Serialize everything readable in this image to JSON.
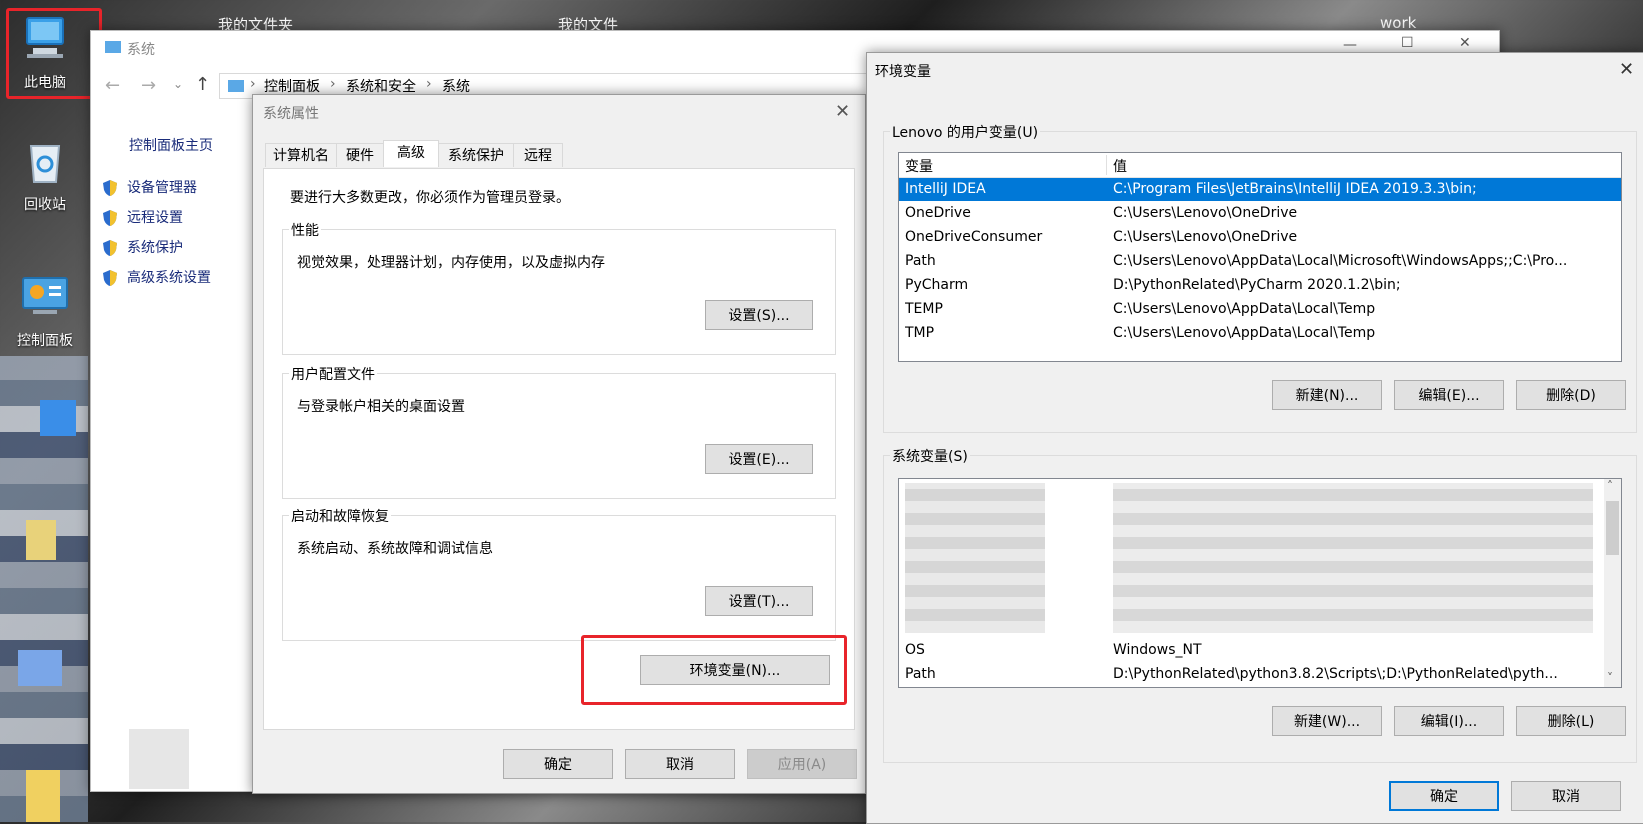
{
  "desktop": {
    "icons": [
      {
        "label": "此电脑",
        "icon": "computer-icon"
      },
      {
        "label": "回收站",
        "icon": "recycle-bin-icon"
      },
      {
        "label": "控制面板",
        "icon": "control-panel-icon"
      }
    ],
    "taskbar_labels": [
      "我的文件夹",
      "我的文件",
      "work"
    ]
  },
  "explorer": {
    "title": "系统",
    "breadcrumb": [
      "控制面板",
      "系统和安全",
      "系统"
    ],
    "sidebar_title": "控制面板主页",
    "sidebar_items": [
      "设备管理器",
      "远程设置",
      "系统保护",
      "高级系统设置"
    ]
  },
  "sysprops": {
    "title": "系统属性",
    "tabs": [
      "计算机名",
      "硬件",
      "高级",
      "系统保护",
      "远程"
    ],
    "active_tab": "高级",
    "admin_note": "要进行大多数更改，你必须作为管理员登录。",
    "groups": [
      {
        "title": "性能",
        "desc": "视觉效果，处理器计划，内存使用，以及虚拟内存",
        "button": "设置(S)..."
      },
      {
        "title": "用户配置文件",
        "desc": "与登录帐户相关的桌面设置",
        "button": "设置(E)..."
      },
      {
        "title": "启动和故障恢复",
        "desc": "系统启动、系统故障和调试信息",
        "button": "设置(T)..."
      }
    ],
    "env_button": "环境变量(N)...",
    "ok": "确定",
    "cancel": "取消",
    "apply": "应用(A)"
  },
  "envvars": {
    "title": "环境变量",
    "user_group_title": "Lenovo 的用户变量(U)",
    "col_var": "变量",
    "col_val": "值",
    "user_vars": [
      {
        "name": "IntelliJ IDEA",
        "value": "C:\\Program Files\\JetBrains\\IntelliJ IDEA 2019.3.3\\bin;"
      },
      {
        "name": "OneDrive",
        "value": "C:\\Users\\Lenovo\\OneDrive"
      },
      {
        "name": "OneDriveConsumer",
        "value": "C:\\Users\\Lenovo\\OneDrive"
      },
      {
        "name": "Path",
        "value": "C:\\Users\\Lenovo\\AppData\\Local\\Microsoft\\WindowsApps;;C:\\Pro..."
      },
      {
        "name": "PyCharm",
        "value": "D:\\PythonRelated\\PyCharm 2020.1.2\\bin;"
      },
      {
        "name": "TEMP",
        "value": "C:\\Users\\Lenovo\\AppData\\Local\\Temp"
      },
      {
        "name": "TMP",
        "value": "C:\\Users\\Lenovo\\AppData\\Local\\Temp"
      }
    ],
    "user_buttons": [
      "新建(N)...",
      "编辑(E)...",
      "删除(D)"
    ],
    "sys_group_title": "系统变量(S)",
    "sys_vars_visible": [
      {
        "name": "OS",
        "value": "Windows_NT"
      },
      {
        "name": "Path",
        "value": "D:\\PythonRelated\\python3.8.2\\Scripts\\;D:\\PythonRelated\\pyth..."
      }
    ],
    "sys_buttons": [
      "新建(W)...",
      "编辑(I)...",
      "删除(L)"
    ],
    "ok": "确定",
    "cancel": "取消"
  },
  "colors": {
    "selection": "#0078d7",
    "highlight_box": "#e8242a"
  }
}
